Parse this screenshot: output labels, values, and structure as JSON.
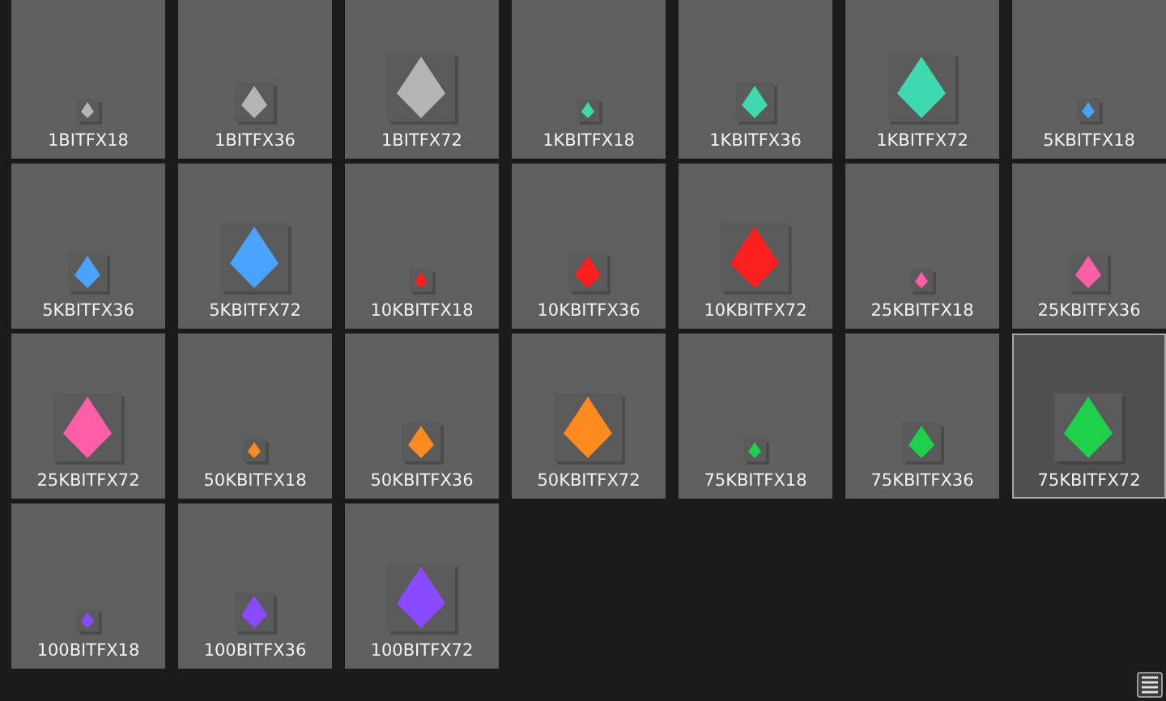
{
  "tiles": [
    {
      "label": "1BITFX18",
      "kind": "small",
      "color": "#b4b4b4",
      "selected": false
    },
    {
      "label": "1BITFX36",
      "kind": "medium",
      "color": "#b4b4b4",
      "selected": false
    },
    {
      "label": "1BITFX72",
      "kind": "large",
      "color": "#b4b4b4",
      "selected": false
    },
    {
      "label": "1KBITFX18",
      "kind": "small",
      "color": "#3fd9b0",
      "selected": false
    },
    {
      "label": "1KBITFX36",
      "kind": "medium",
      "color": "#3fd9b0",
      "selected": false
    },
    {
      "label": "1KBITFX72",
      "kind": "large",
      "color": "#3fd9b0",
      "selected": false
    },
    {
      "label": "5KBITFX18",
      "kind": "small",
      "color": "#4aa3ff",
      "selected": false
    },
    {
      "label": "5KBITFX36",
      "kind": "medium",
      "color": "#4aa3ff",
      "selected": false
    },
    {
      "label": "5KBITFX72",
      "kind": "large",
      "color": "#4aa3ff",
      "selected": false
    },
    {
      "label": "10KBITFX18",
      "kind": "small",
      "color": "#ff1f1f",
      "selected": false
    },
    {
      "label": "10KBITFX36",
      "kind": "medium",
      "color": "#ff1f1f",
      "selected": false
    },
    {
      "label": "10KBITFX72",
      "kind": "large",
      "color": "#ff1f1f",
      "selected": false
    },
    {
      "label": "25KBITFX18",
      "kind": "small",
      "color": "#ff5fa8",
      "selected": false
    },
    {
      "label": "25KBITFX36",
      "kind": "medium",
      "color": "#ff5fa8",
      "selected": false
    },
    {
      "label": "25KBITFX72",
      "kind": "large",
      "color": "#ff5fa8",
      "selected": false
    },
    {
      "label": "50KBITFX18",
      "kind": "small",
      "color": "#ff8a1f",
      "selected": false
    },
    {
      "label": "50KBITFX36",
      "kind": "medium",
      "color": "#ff8a1f",
      "selected": false
    },
    {
      "label": "50KBITFX72",
      "kind": "large",
      "color": "#ff8a1f",
      "selected": false
    },
    {
      "label": "75KBITFX18",
      "kind": "small",
      "color": "#1fd04a",
      "selected": false
    },
    {
      "label": "75KBITFX36",
      "kind": "medium",
      "color": "#1fd04a",
      "selected": false
    },
    {
      "label": "75KBITFX72",
      "kind": "large",
      "color": "#1fd04a",
      "selected": true
    },
    {
      "label": "100BITFX18",
      "kind": "small",
      "color": "#8a4aff",
      "selected": false
    },
    {
      "label": "100BITFX36",
      "kind": "medium",
      "color": "#8a4aff",
      "selected": false
    },
    {
      "label": "100BITFX72",
      "kind": "large",
      "color": "#8a4aff",
      "selected": false
    }
  ]
}
